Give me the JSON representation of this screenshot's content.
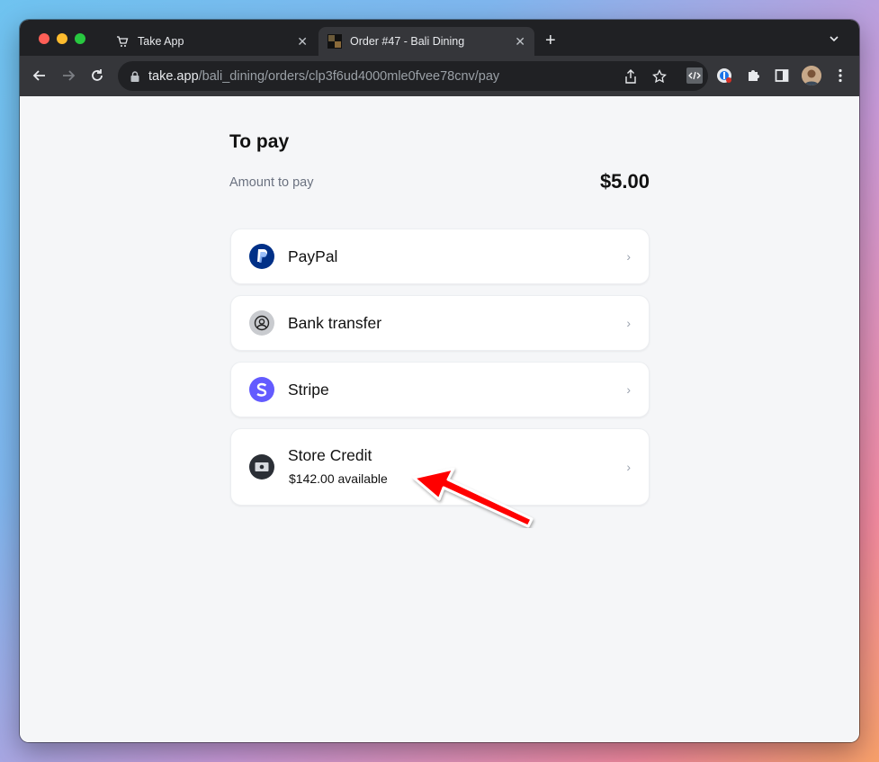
{
  "browser": {
    "tabs": [
      {
        "title": "Take App",
        "close": "✕"
      },
      {
        "title": "Order #47 - Bali Dining",
        "close": "✕"
      }
    ],
    "new_tab": "+",
    "url_host": "take.app",
    "url_path": "/bali_dining/orders/clp3f6ud4000mle0fvee78cnv/pay"
  },
  "page": {
    "title": "To pay",
    "amount_label": "Amount to pay",
    "amount_value": "$5.00",
    "methods": [
      {
        "label": "PayPal",
        "icon": "paypal-icon",
        "color": "#003087"
      },
      {
        "label": "Bank transfer",
        "icon": "user-circle-icon",
        "color": "#c9cbcf"
      },
      {
        "label": "Stripe",
        "icon": "stripe-icon",
        "color": "#635bff"
      },
      {
        "label": "Store Credit",
        "sub": "$142.00 available",
        "icon": "banknote-icon",
        "color": "#2b2f36"
      }
    ],
    "chevron": "›"
  },
  "annotation": {
    "color": "#ff0000"
  }
}
